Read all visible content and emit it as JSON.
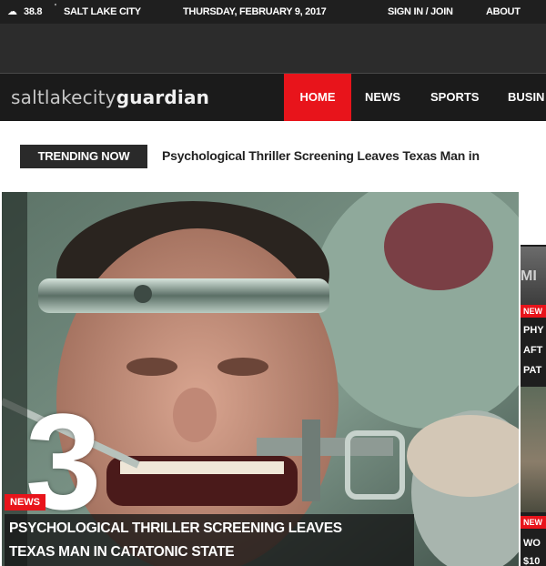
{
  "topbar": {
    "weather_icon": "cloud-icon",
    "temperature": "38.8",
    "degree_mark": "'",
    "city": "SALT LAKE CITY",
    "date": "THURSDAY, FEBRUARY 9, 2017",
    "signin_label": "SIGN IN / JOIN",
    "about_label": "ABOUT"
  },
  "navbar": {
    "logo_part1": "saltlakecity",
    "logo_part2": "guardian",
    "items": [
      {
        "label": "HOME",
        "active": true
      },
      {
        "label": "NEWS"
      },
      {
        "label": "SPORTS"
      },
      {
        "label": "BUSIN"
      }
    ]
  },
  "trending": {
    "badge": "TRENDING NOW",
    "headline": "Psychological Thriller Screening Leaves Texas Man in"
  },
  "hero": {
    "number": "3",
    "tag": "NEWS",
    "title_line1": "PSYCHOLOGICAL THRILLER SCREENING LEAVES",
    "title_line2": "TEXAS MAN IN CATATONIC STATE"
  },
  "side": {
    "image_mark": "MI",
    "tag1": "NEW",
    "line1": "PHY",
    "line2": "AFT",
    "line3": "PAT",
    "tag2": "NEW",
    "line4": "WO",
    "line5": "$10"
  },
  "colors": {
    "accent": "#e8141b",
    "topbar_bg": "#1f1f1f",
    "nav_bg": "#1b1b1b",
    "badge_bg": "#2a2a2a"
  }
}
